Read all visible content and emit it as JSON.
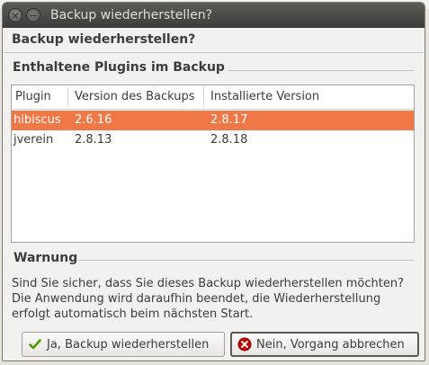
{
  "window": {
    "title": "Backup wiederherstellen?"
  },
  "dialog": {
    "heading": "Backup wiederherstellen?",
    "plugins_group_label": "Enthaltene Plugins im Backup",
    "columns": [
      "Plugin",
      "Version des Backups",
      "Installierte Version"
    ],
    "rows": [
      {
        "plugin": "hibiscus",
        "backup_version": "2.6.16",
        "installed_version": "2.8.17",
        "selected": true
      },
      {
        "plugin": "jverein",
        "backup_version": "2.8.13",
        "installed_version": "2.8.18",
        "selected": false
      }
    ],
    "warning_label": "Warnung",
    "warning_lines": [
      "Sind Sie sicher, dass Sie dieses Backup wiederherstellen möchten?",
      "Die Anwendung wird daraufhin beendet, die Wiederherstellung",
      "erfolgt automatisch beim nächsten Start."
    ],
    "confirm_button": "Ja, Backup wiederherstellen",
    "cancel_button": "Nein, Vorgang abbrechen"
  },
  "colors": {
    "selection": "#f07746",
    "titlebar": "#3c3b37",
    "confirm_icon": "#4e9a06",
    "cancel_icon": "#cc0000"
  },
  "icons": {
    "close": "close-icon",
    "minimize": "minimize-icon",
    "confirm": "checkmark-icon",
    "cancel": "cancel-icon"
  }
}
